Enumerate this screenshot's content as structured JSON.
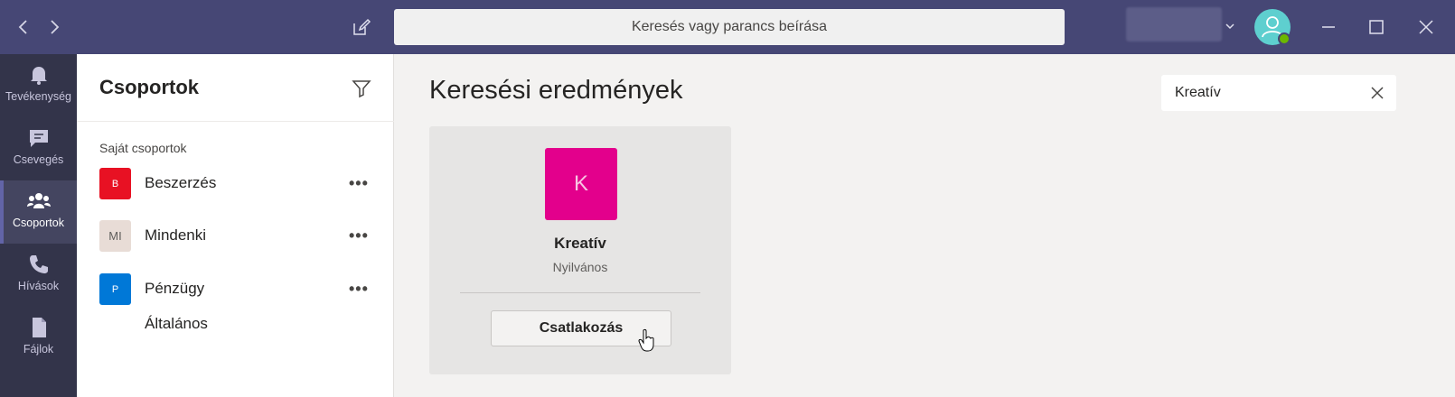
{
  "topbar": {
    "search_placeholder": "Keresés vagy parancs beírása",
    "icons": [
      "back-arrow-icon",
      "forward-arrow-icon",
      "compose-icon",
      "chevron-down-icon",
      "minimize-icon",
      "maximize-icon",
      "close-icon"
    ]
  },
  "rail": {
    "items": [
      {
        "label": "Tevékenység",
        "icon": "bell-icon"
      },
      {
        "label": "Csevegés",
        "icon": "chat-icon"
      },
      {
        "label": "Csoportok",
        "icon": "teams-icon",
        "active": true
      },
      {
        "label": "Hívások",
        "icon": "phone-icon"
      },
      {
        "label": "Fájlok",
        "icon": "file-icon"
      }
    ]
  },
  "panel": {
    "title": "Csoportok",
    "section_label": "Saját csoportok",
    "teams": [
      {
        "initials": "B",
        "name": "Beszerzés",
        "color": "#e81123"
      },
      {
        "initials": "MI",
        "name": "Mindenki",
        "color": "#e8dcd6"
      },
      {
        "initials": "P",
        "name": "Pénzügy",
        "color": "#0078d7"
      }
    ],
    "channel": "Általános",
    "more_label": "•••"
  },
  "main": {
    "title": "Keresési eredmények",
    "search_value": "Kreatív",
    "result": {
      "initial": "K",
      "name": "Kreatív",
      "type": "Nyilvános",
      "join_label": "Csatlakozás",
      "color": "#e3008c"
    }
  }
}
